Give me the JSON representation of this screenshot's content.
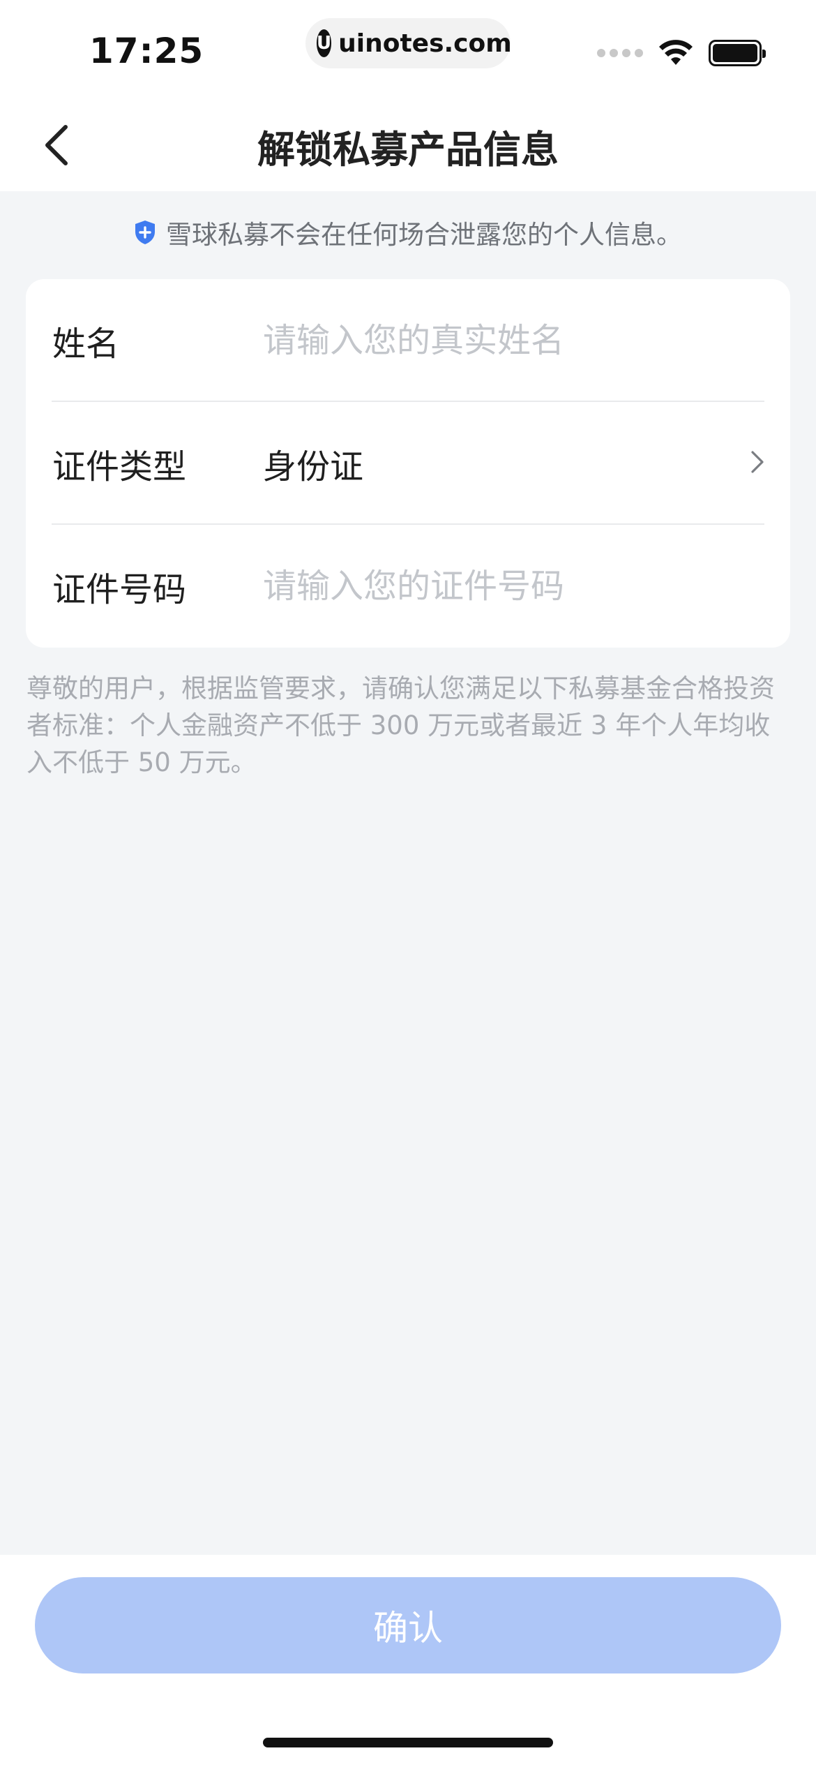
{
  "status_bar": {
    "time": "17:25",
    "url": "uinotes.com",
    "url_logo": "U",
    "icons": [
      "signal-icon",
      "wifi-icon",
      "battery-icon"
    ]
  },
  "nav": {
    "back_icon": "chevron-left-icon",
    "title": "解锁私募产品信息"
  },
  "privacy_notice": {
    "icon": "shield-plus-icon",
    "text": "雪球私募不会在任何场合泄露您的个人信息。"
  },
  "form": {
    "name": {
      "label": "姓名",
      "value": "",
      "placeholder": "请输入您的真实姓名"
    },
    "id_type": {
      "label": "证件类型",
      "value": "身份证",
      "chevron_icon": "chevron-right-icon"
    },
    "id_number": {
      "label": "证件号码",
      "value": "",
      "placeholder": "请输入您的证件号码"
    }
  },
  "disclaimer": "尊敬的用户，根据监管要求，请确认您满足以下私募基金合格投资者标准：个人金融资产不低于 300 万元或者最近 3 年个人年均收入不低于 50 万元。",
  "confirm_button": {
    "label": "确认",
    "enabled": false
  },
  "colors": {
    "accent_disabled": "#aec6f7",
    "shield": "#3f7bf0",
    "background": "#f3f5f7"
  }
}
